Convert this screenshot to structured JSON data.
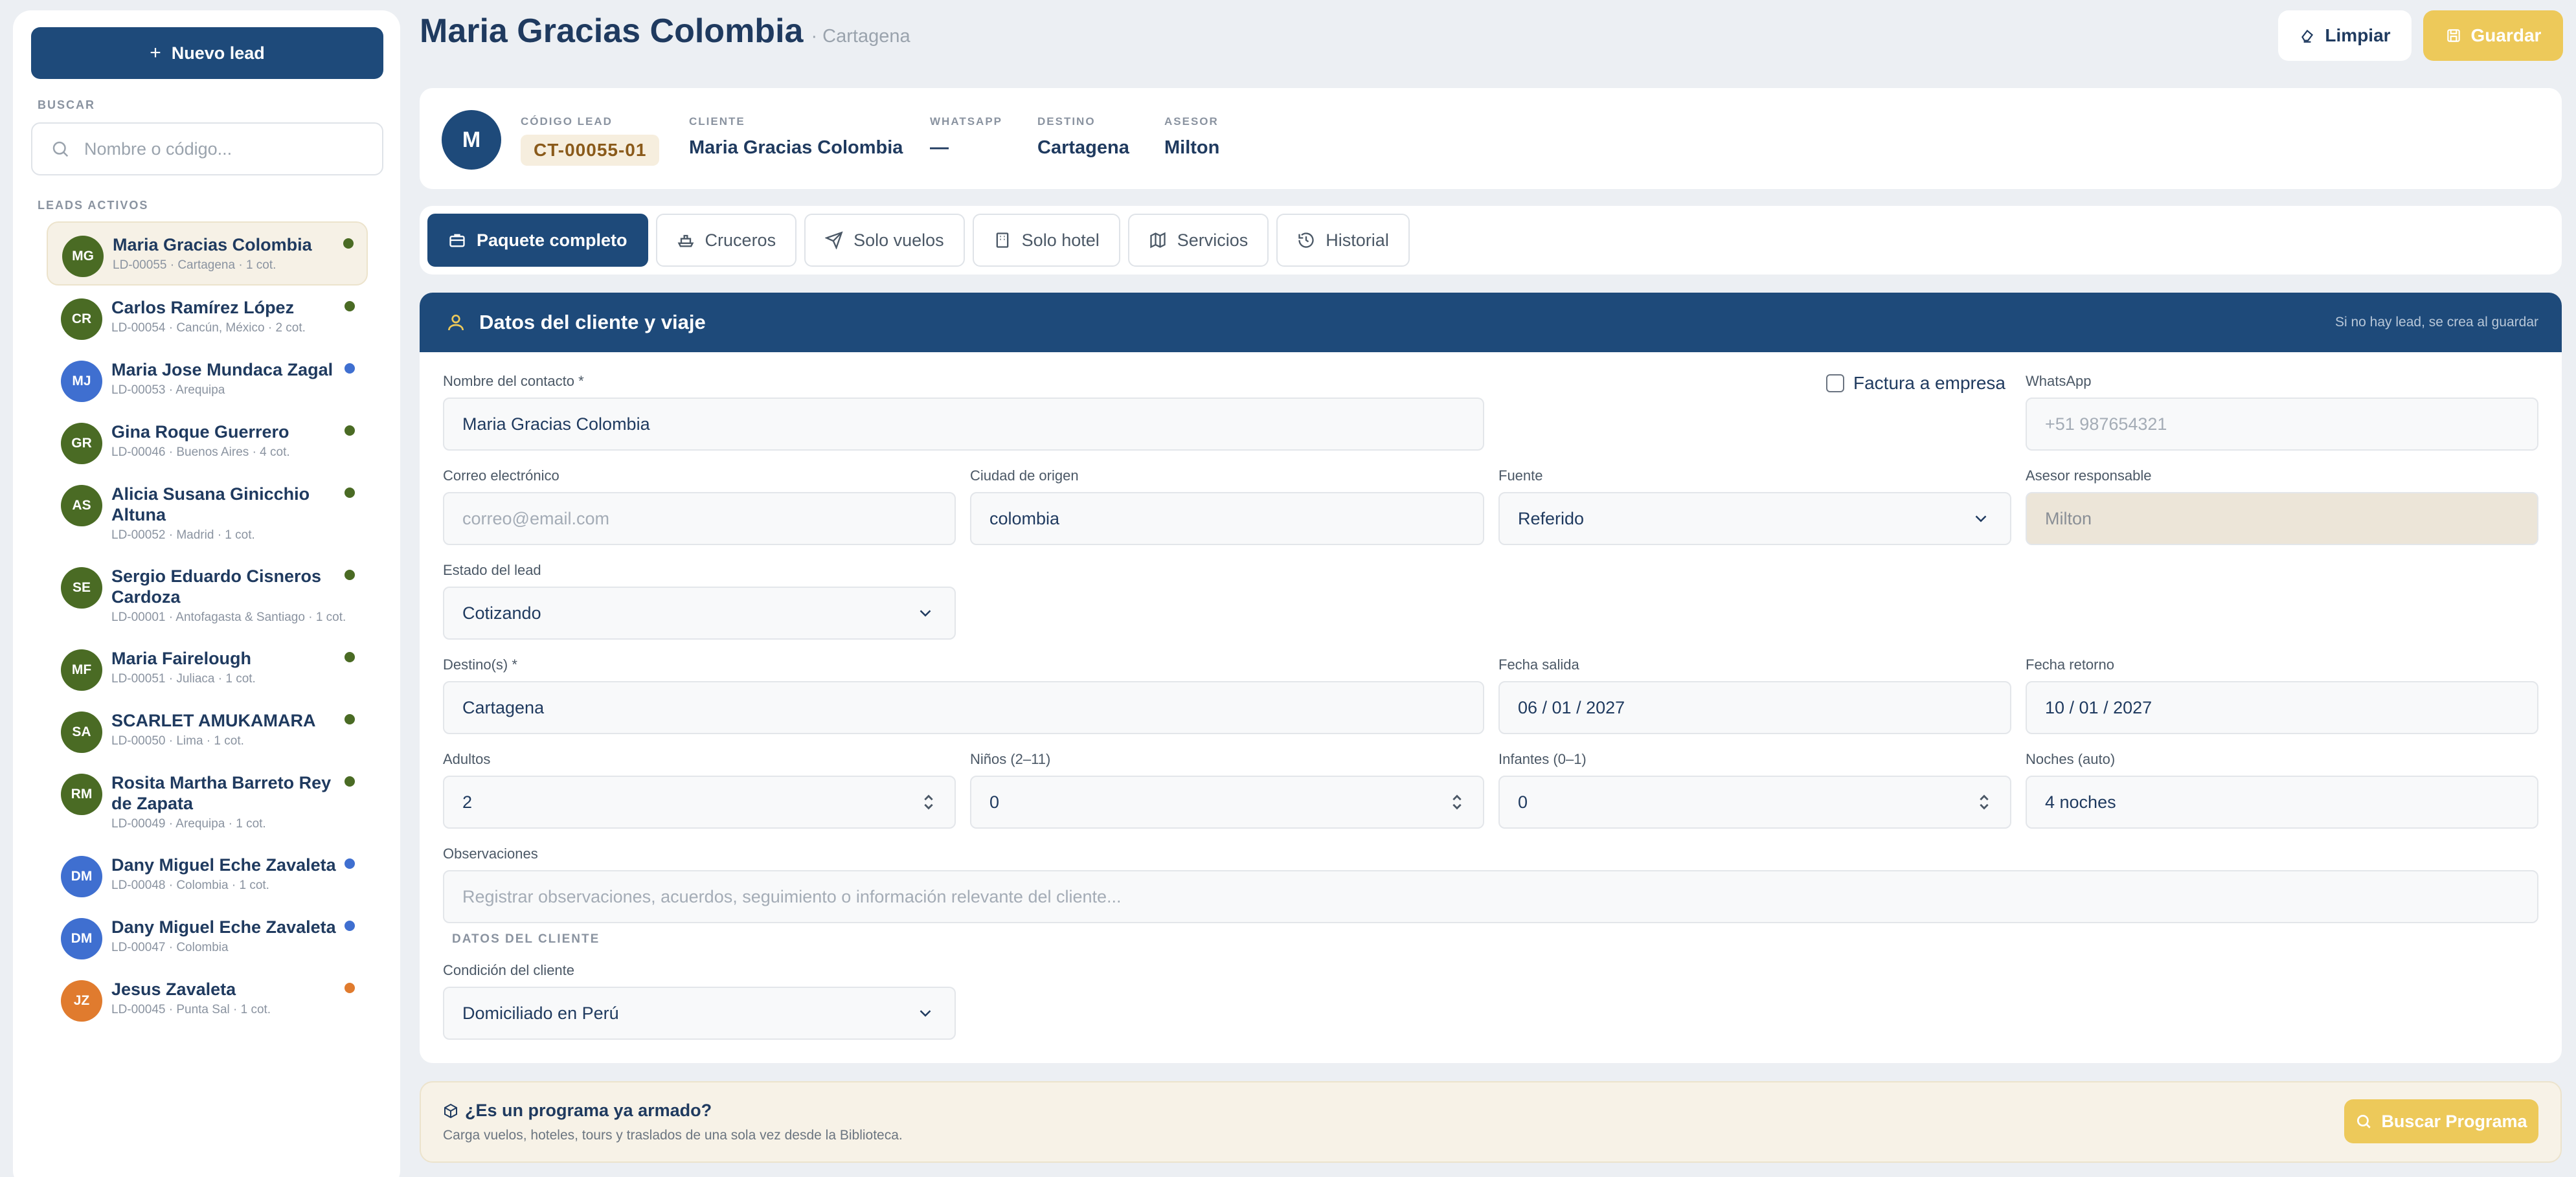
{
  "sidebar": {
    "new_lead_label": "Nuevo lead",
    "search_label": "BUSCAR",
    "search_placeholder": "Nombre o código...",
    "leads_label": "LEADS ACTIVOS",
    "leads": [
      {
        "initials": "MG",
        "name": "Maria Gracias Colombia",
        "sub": "LD-00055 · Cartagena · 1 cot.",
        "avatar_color": "#4a6b24",
        "dot_color": "#4a6b24",
        "active": true
      },
      {
        "initials": "CR",
        "name": "Carlos Ramírez López",
        "sub": "LD-00054 · Cancún, México · 2 cot.",
        "avatar_color": "#4a6b24",
        "dot_color": "#4a6b24"
      },
      {
        "initials": "MJ",
        "name": "Maria Jose Mundaca Zagal",
        "sub": "LD-00053 · Arequipa",
        "avatar_color": "#3f6fd0",
        "dot_color": "#3f6fd0"
      },
      {
        "initials": "GR",
        "name": "Gina Roque Guerrero",
        "sub": "LD-00046 · Buenos Aires · 4 cot.",
        "avatar_color": "#4a6b24",
        "dot_color": "#4a6b24"
      },
      {
        "initials": "AS",
        "name": "Alicia Susana Ginicchio Altuna",
        "sub": "LD-00052 · Madrid · 1 cot.",
        "avatar_color": "#4a6b24",
        "dot_color": "#4a6b24"
      },
      {
        "initials": "SE",
        "name": "Sergio Eduardo Cisneros Cardoza",
        "sub": "LD-00001 · Antofagasta & Santiago · 1 cot.",
        "avatar_color": "#4a6b24",
        "dot_color": "#4a6b24"
      },
      {
        "initials": "MF",
        "name": "Maria Fairelough",
        "sub": "LD-00051 · Juliaca · 1 cot.",
        "avatar_color": "#4a6b24",
        "dot_color": "#4a6b24"
      },
      {
        "initials": "SA",
        "name": "SCARLET AMUKAMARA",
        "sub": "LD-00050 · Lima · 1 cot.",
        "avatar_color": "#4a6b24",
        "dot_color": "#4a6b24"
      },
      {
        "initials": "RM",
        "name": "Rosita Martha Barreto Rey de Zapata",
        "sub": "LD-00049 · Arequipa · 1 cot.",
        "avatar_color": "#4a6b24",
        "dot_color": "#4a6b24"
      },
      {
        "initials": "DM",
        "name": "Dany Miguel Eche Zavaleta",
        "sub": "LD-00048 · Colombia · 1 cot.",
        "avatar_color": "#3f6fd0",
        "dot_color": "#3f6fd0"
      },
      {
        "initials": "DM",
        "name": "Dany Miguel Eche Zavaleta",
        "sub": "LD-00047 · Colombia",
        "avatar_color": "#3f6fd0",
        "dot_color": "#3f6fd0"
      },
      {
        "initials": "JZ",
        "name": "Jesus Zavaleta",
        "sub": "LD-00045 · Punta Sal · 1 cot.",
        "avatar_color": "#e07b2e",
        "dot_color": "#e07b2e"
      }
    ]
  },
  "header": {
    "title": "Maria Gracias Colombia",
    "city": "· Cartagena",
    "limpiar_label": "Limpiar",
    "guardar_label": "Guardar"
  },
  "info": {
    "avatar": "M",
    "code_label": "CÓDIGO LEAD",
    "code_value": "CT-00055-01",
    "client_label": "CLIENTE",
    "client_value": "Maria Gracias Colombia",
    "whatsapp_label": "WHATSAPP",
    "whatsapp_value": "—",
    "destino_label": "DESTINO",
    "destino_value": "Cartagena",
    "asesor_label": "ASESOR",
    "asesor_value": "Milton"
  },
  "tabs": [
    "Paquete completo",
    "Cruceros",
    "Solo vuelos",
    "Solo hotel",
    "Servicios",
    "Historial"
  ],
  "form": {
    "title": "Datos del cliente y viaje",
    "hint": "Si no hay lead, se crea al guardar",
    "contact_label": "Nombre del contacto *",
    "contact_value": "Maria Gracias Colombia",
    "factura_label": "Factura a empresa",
    "whatsapp_label": "WhatsApp",
    "whatsapp_placeholder": "+51 987654321",
    "email_label": "Correo electrónico",
    "email_placeholder": "correo@email.com",
    "ciudad_label": "Ciudad de origen",
    "ciudad_value": "colombia",
    "fuente_label": "Fuente",
    "fuente_value": "Referido",
    "asesor_label": "Asesor responsable",
    "asesor_value": "Milton",
    "estado_label": "Estado del lead",
    "estado_value": "Cotizando",
    "destino_label": "Destino(s) *",
    "destino_value": "Cartagena",
    "salida_label": "Fecha salida",
    "salida_value": "06 / 01 / 2027",
    "retorno_label": "Fecha retorno",
    "retorno_value": "10 / 01 / 2027",
    "adultos_label": "Adultos",
    "adultos_value": "2",
    "ninos_label": "Niños (2–11)",
    "ninos_value": "0",
    "infantes_label": "Infantes (0–1)",
    "infantes_value": "0",
    "noches_label": "Noches (auto)",
    "noches_value": "4 noches",
    "obs_label": "Observaciones",
    "obs_placeholder": "Registrar observaciones, acuerdos, seguimiento o información relevante del cliente...",
    "section_cliente": "DATOS DEL CLIENTE",
    "condicion_label": "Condición del cliente",
    "condicion_value": "Domiciliado en Perú"
  },
  "programa": {
    "title": "¿Es un programa ya armado?",
    "sub": "Carga vuelos, hoteles, tours y traslados de una sola vez desde la Biblioteca.",
    "button": "Buscar Programa"
  }
}
